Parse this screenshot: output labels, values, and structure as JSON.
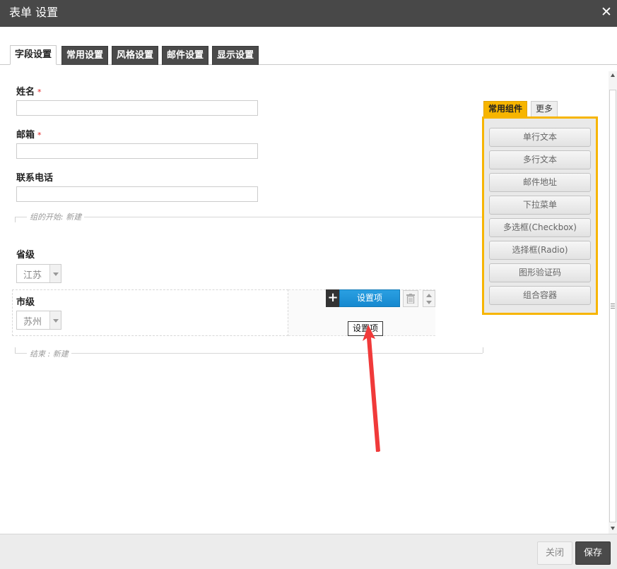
{
  "dialog": {
    "title": "表单 设置",
    "close_glyph": "✕"
  },
  "tabs": [
    {
      "label": "字段设置",
      "active": true
    },
    {
      "label": "常用设置"
    },
    {
      "label": "风格设置"
    },
    {
      "label": "邮件设置"
    },
    {
      "label": "显示设置"
    }
  ],
  "form": {
    "fields": [
      {
        "label": "姓名",
        "required": true,
        "value": ""
      },
      {
        "label": "邮箱",
        "required": true,
        "value": ""
      },
      {
        "label": "联系电话",
        "required": false,
        "value": ""
      }
    ],
    "required_mark": "*",
    "group_start_label": "组的开始: 新建",
    "group_end_label": "结束 : 新建",
    "province": {
      "label": "省级",
      "selected": "江苏"
    },
    "city": {
      "label": "市级",
      "selected": "苏州"
    },
    "actions": {
      "add_glyph": "+",
      "settings_label": "设置项",
      "tooltip": "设置项"
    }
  },
  "widget_panel": {
    "tabs": [
      {
        "label": "常用组件",
        "active": true
      },
      {
        "label": "更多"
      }
    ],
    "items": [
      "单行文本",
      "多行文本",
      "邮件地址",
      "下拉菜单",
      "多选框(Checkbox)",
      "选择框(Radio)",
      "图形验证码",
      "组合容器"
    ],
    "accent_color": "#f7b500"
  },
  "footer": {
    "close_label": "关闭",
    "save_label": "保存"
  },
  "colors": {
    "titlebar": "#484848",
    "primary_button": "#1789cf",
    "annotation_arrow": "#f03a3a"
  }
}
